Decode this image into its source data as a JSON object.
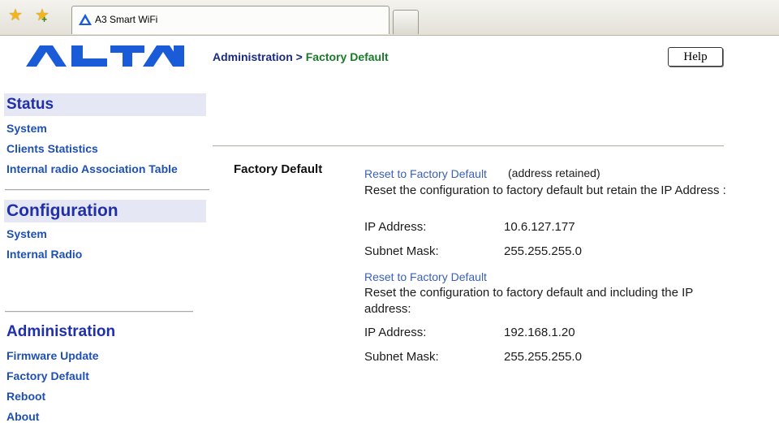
{
  "browser": {
    "tab_title": "A3 Smart WiFi",
    "new_tab_label": ""
  },
  "brand": {
    "name": "ALTAI",
    "color": "#1a5cd8"
  },
  "nav": {
    "status": {
      "heading": "Status",
      "items": [
        "System",
        "Clients Statistics",
        "Internal radio Association Table"
      ]
    },
    "configuration": {
      "heading": "Configuration",
      "items": [
        "System",
        "Internal Radio"
      ]
    },
    "administration": {
      "heading": "Administration",
      "items": [
        "Firmware Update",
        "Factory Default",
        "Reboot",
        "About"
      ]
    }
  },
  "breadcrumb": {
    "section": "Administration >",
    "page": "Factory Default"
  },
  "help_label": "Help",
  "content": {
    "section_label": "Factory Default",
    "option1": {
      "link": "Reset to Factory Default",
      "suffix": "(address retained)",
      "desc": "Reset the configuration to factory default but retain the IP Address :",
      "ip_label": "IP Address:",
      "ip_value": "10.6.127.177",
      "mask_label": "Subnet Mask:",
      "mask_value": "255.255.255.0"
    },
    "option2": {
      "link": "Reset to Factory Default",
      "desc": "Reset the configuration to factory default and including the IP address:",
      "ip_label": "IP Address:",
      "ip_value": "192.168.1.20",
      "mask_label": "Subnet Mask:",
      "mask_value": "255.255.255.0"
    }
  }
}
